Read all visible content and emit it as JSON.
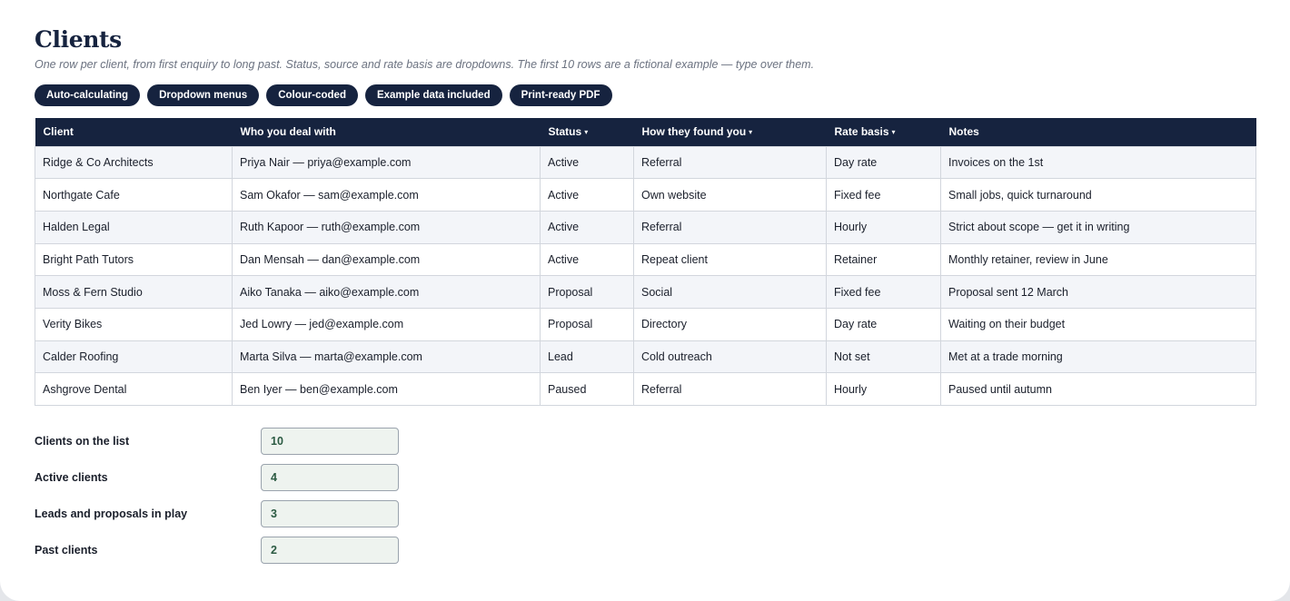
{
  "page": {
    "title": "Clients",
    "subtitle": "One row per client, from first enquiry to long past. Status, source and rate basis are dropdowns. The first 10 rows are a fictional example — type over them."
  },
  "badges": [
    "Auto-calculating",
    "Dropdown menus",
    "Colour-coded",
    "Example data included",
    "Print-ready PDF"
  ],
  "table": {
    "headers": [
      {
        "label": "Client",
        "dropdown": false
      },
      {
        "label": "Who you deal with",
        "dropdown": false
      },
      {
        "label": "Status",
        "dropdown": true
      },
      {
        "label": "How they found you",
        "dropdown": true
      },
      {
        "label": "Rate basis",
        "dropdown": true
      },
      {
        "label": "Notes",
        "dropdown": false
      }
    ],
    "dropdown_caret": "▾",
    "rows": [
      [
        "Ridge & Co Architects",
        "Priya Nair — priya@example.com",
        "Active",
        "Referral",
        "Day rate",
        "Invoices on the 1st"
      ],
      [
        "Northgate Cafe",
        "Sam Okafor — sam@example.com",
        "Active",
        "Own website",
        "Fixed fee",
        "Small jobs, quick turnaround"
      ],
      [
        "Halden Legal",
        "Ruth Kapoor — ruth@example.com",
        "Active",
        "Referral",
        "Hourly",
        "Strict about scope — get it in writing"
      ],
      [
        "Bright Path Tutors",
        "Dan Mensah — dan@example.com",
        "Active",
        "Repeat client",
        "Retainer",
        "Monthly retainer, review in June"
      ],
      [
        "Moss & Fern Studio",
        "Aiko Tanaka — aiko@example.com",
        "Proposal",
        "Social",
        "Fixed fee",
        "Proposal sent 12 March"
      ],
      [
        "Verity Bikes",
        "Jed Lowry — jed@example.com",
        "Proposal",
        "Directory",
        "Day rate",
        "Waiting on their budget"
      ],
      [
        "Calder Roofing",
        "Marta Silva — marta@example.com",
        "Lead",
        "Cold outreach",
        "Not set",
        "Met at a trade morning"
      ],
      [
        "Ashgrove Dental",
        "Ben Iyer — ben@example.com",
        "Paused",
        "Referral",
        "Hourly",
        "Paused until autumn"
      ]
    ]
  },
  "summary": [
    {
      "label": "Clients on the list",
      "value": "10"
    },
    {
      "label": "Active clients",
      "value": "4"
    },
    {
      "label": "Leads and proposals in play",
      "value": "3"
    },
    {
      "label": "Past clients",
      "value": "2"
    }
  ],
  "colors": {
    "navy": "#16233f",
    "row_alt": "#f3f5f9",
    "stat_fill": "#eef3ef",
    "stat_text": "#2b5a42"
  }
}
